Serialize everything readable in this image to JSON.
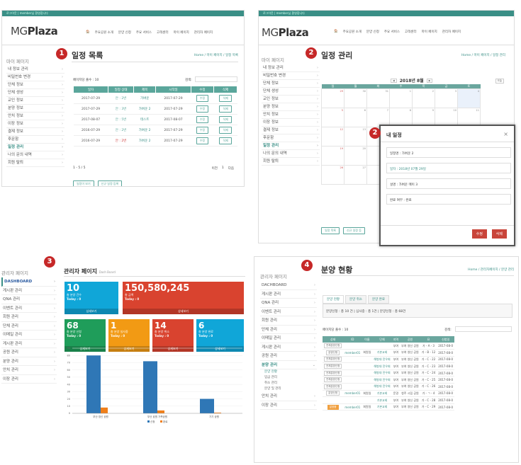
{
  "brand": {
    "logo_a": "MG",
    "logo_b": "Plaza",
    "topbar": "로그아웃 | member님 환영합니다"
  },
  "nav": [
    "🏠",
    "주요공원 소개",
    "분양 신청",
    "주요 서비스",
    "고객센터",
    "마이 페이지",
    "관리자 페이지"
  ],
  "nav2": [
    "🏠",
    "주요공원 소개",
    "분양 신청",
    "주요 서비스",
    "고객센터",
    "마이 페이지",
    "관리자 페이지"
  ],
  "panel1": {
    "num": "1",
    "title": "일정 목록",
    "crumb": "Home / 마이 페이지 / 일정 목록",
    "side_head": "마이 페이지",
    "side": [
      "내 정보 관리",
      "비밀번호 변경",
      "단체 정보",
      "단체 생성",
      "교인 정보",
      "분양 정보",
      "안치 정보",
      "이장 정보",
      "결제 정보",
      "후문함",
      "일정 관리",
      "나의 문의 내역",
      "회원 탈퇴"
    ],
    "page_size_label": "페이지당 출수 : 10",
    "search_label": "검색:",
    "cols": [
      "일자",
      "일정 상태",
      "제목",
      "시작일",
      "수정",
      "삭제"
    ],
    "rows": [
      [
        "2017-07-29",
        "안 : 2번",
        "가벼운",
        "2017-07-29"
      ],
      [
        "2017-07-29",
        "안 : 3번",
        "가벼운 2",
        "2017-07-29"
      ],
      [
        "2017-08-07",
        "안 : 5번",
        "테스트",
        "2017-08-07"
      ],
      [
        "2016-07-29",
        "안 : 2번",
        "가벼운 2",
        "2017-07-29"
      ],
      [
        "2016-07-29",
        "안 : 2번",
        "가벼운 2",
        "2017-07-29"
      ]
    ],
    "edit": "수정",
    "del": "삭제",
    "paging": "1 - 5 / 5",
    "prev": "이전",
    "page": "1",
    "next": "다음",
    "btn1": "일정이 보기",
    "btn2": "신규 일정 등록"
  },
  "panel2": {
    "num": "2",
    "title": "일정 관리",
    "crumb": "Home / 마이 페이지 / 일정 관리",
    "side_head": "마이 페이지",
    "side": [
      "내 정보 관리",
      "비밀번호 변경",
      "단체 정보",
      "단체 생성",
      "교인 정보",
      "분양 정보",
      "안치 정보",
      "이장 정보",
      "결제 정보",
      "후문함",
      "일정 관리",
      "나의 문의 내역",
      "회원 탈퇴"
    ],
    "month": "2018년 8월",
    "today": "오늘",
    "days": [
      "일",
      "월",
      "화",
      "수",
      "목",
      "금",
      "토"
    ],
    "btn1": "일정 목록",
    "btn2": "신규 일정 등"
  },
  "modal": {
    "num": "2",
    "title": "내 일정",
    "close": "×",
    "f1": "일정명 : 가벼운 2",
    "f2": "일자 : 2018년 07월 29일",
    "f3": "설명 : 가벼운 메이 3",
    "f4": "완료 여부 : 완료",
    "edit": "수정",
    "del": "삭제"
  },
  "panel3": {
    "num": "3",
    "title": "관리자 페이지",
    "sub": "Dash Board",
    "side_head": "관리자 페이지",
    "side": [
      "DASHBOARD",
      "게시판 관리",
      "QNA 관리",
      "이벤트 관리",
      "회원 관리",
      "단체 관리",
      "이메일 관리",
      "게시판 관리",
      "공원 관리",
      "분양 관리",
      "안치 관리",
      "이장 관리"
    ],
    "cards": [
      {
        "v": "10",
        "l": "총 분양 건수",
        "t": "Today : 0",
        "f": "상세보기",
        "c": "#10a6d8"
      },
      {
        "v": "150,580,245",
        "l": "총 금액",
        "t": "Today : 0",
        "f": "상세보기",
        "c": "#d9432f"
      },
      {
        "v": "68",
        "l": "총 분양 신청",
        "t": "Today : 0",
        "f": "상세보기",
        "c": "#1f9d5a"
      },
      {
        "v": "1",
        "l": "총 분양 실사중",
        "t": "Today : 0",
        "f": "상세보기",
        "c": "#f29a14"
      },
      {
        "v": "14",
        "l": "총 분양 취소",
        "t": "Today : 0",
        "f": "상세보기",
        "c": "#d9432f"
      },
      {
        "v": "6",
        "l": "총 분양 완료",
        "t": "Today : 0",
        "f": "상세보기",
        "c": "#10a6d8"
      }
    ],
    "chart_data": {
      "type": "bar",
      "categories": [
        "부산 영신 공원",
        "부산 효원 가족공원",
        "기기 공원"
      ],
      "series": [
        {
          "name": "신청",
          "values": [
            80,
            72,
            20
          ]
        },
        {
          "name": "완료",
          "values": [
            8,
            4,
            1
          ]
        }
      ],
      "ylim": [
        0,
        90
      ],
      "yticks": [
        "0",
        "10",
        "20",
        "30",
        "40",
        "50",
        "60",
        "70",
        "80",
        "90"
      ],
      "legend": [
        "신청",
        "완료"
      ],
      "colors": [
        "#2f77b6",
        "#f07f1a"
      ]
    }
  },
  "panel4": {
    "num": "4",
    "title": "분양 현황",
    "crumb": "Home / 관리자페이지 / 분양 관리",
    "side_head": "관리자 페이지",
    "side": [
      "DACHBOARD",
      "게시판 관리",
      "QNA 관리",
      "이벤트 관리",
      "회원 관리",
      "단체 관리",
      "이메일 관리",
      "게시판 관리",
      "공원 관리",
      "분양 관리"
    ],
    "sub": [
      "분양 현황",
      "입금 관리",
      "취소 관리",
      "분양 및 관리"
    ],
    "side_after": [
      "안치 관리",
      "이장 관리"
    ],
    "tabs": [
      "분양 현황",
      "분양 취소",
      "분양 완료"
    ],
    "summary": "분양신청 : 총 10 건 | 심사중 : 총 1건 | 분양신청 : 총 68건",
    "page_size_label": "페이지당 출수 : 10",
    "search_label": "검색:",
    "cols": [
      "상태",
      "ID",
      "이름",
      "단체",
      "지역",
      "공원",
      "묘",
      "신청일"
    ],
    "rows": [
      [
        "전체분양신청",
        "",
        "",
        "",
        "부여",
        "부여 영신 공원",
        "가 - A - 3",
        "2017-08-0"
      ],
      [
        "분양신청",
        "member01",
        "회원일",
        "기본교회",
        "부여",
        "부여 영신 공원",
        "가 - B - 12",
        "2017-08-0"
      ],
      [
        "전체분양신청",
        "",
        "",
        "해병대 전우회",
        "부여",
        "부여 영신 공원",
        "가 - C - 22",
        "2017-08-0"
      ],
      [
        "전체분양신청",
        "",
        "",
        "해병대 전우회",
        "부여",
        "부여 영신 공원",
        "가 - C - 23",
        "2017-08-0"
      ],
      [
        "전체분양신청",
        "",
        "",
        "해병대 전우회",
        "부여",
        "부여 영신 공원",
        "가 - C - 24",
        "2017-08-0"
      ],
      [
        "전체분양신청",
        "",
        "",
        "해병대 전우회",
        "부여",
        "부여 영신 공원",
        "가 - C - 25",
        "2017-08-0"
      ],
      [
        "전체분양신청",
        "",
        "",
        "해병대 전우회",
        "부여",
        "부여 영신 공원",
        "가 - C - 26",
        "2017-08-0"
      ],
      [
        "분양신청",
        "member01",
        "회원일",
        "기본교회",
        "문경",
        "청주 시립 공원",
        "가 - ㄱ - 4",
        "2017-08-0"
      ],
      [
        "",
        "",
        "",
        "기본교회",
        "부여",
        "부여 영신 공원",
        "가 - C - 28",
        "2017-08-0"
      ],
      [
        "분양중",
        "member01",
        "회원일",
        "기본교회",
        "부여",
        "부여 영신 공원",
        "가 - C - 29",
        "2017-08-0"
      ]
    ]
  }
}
